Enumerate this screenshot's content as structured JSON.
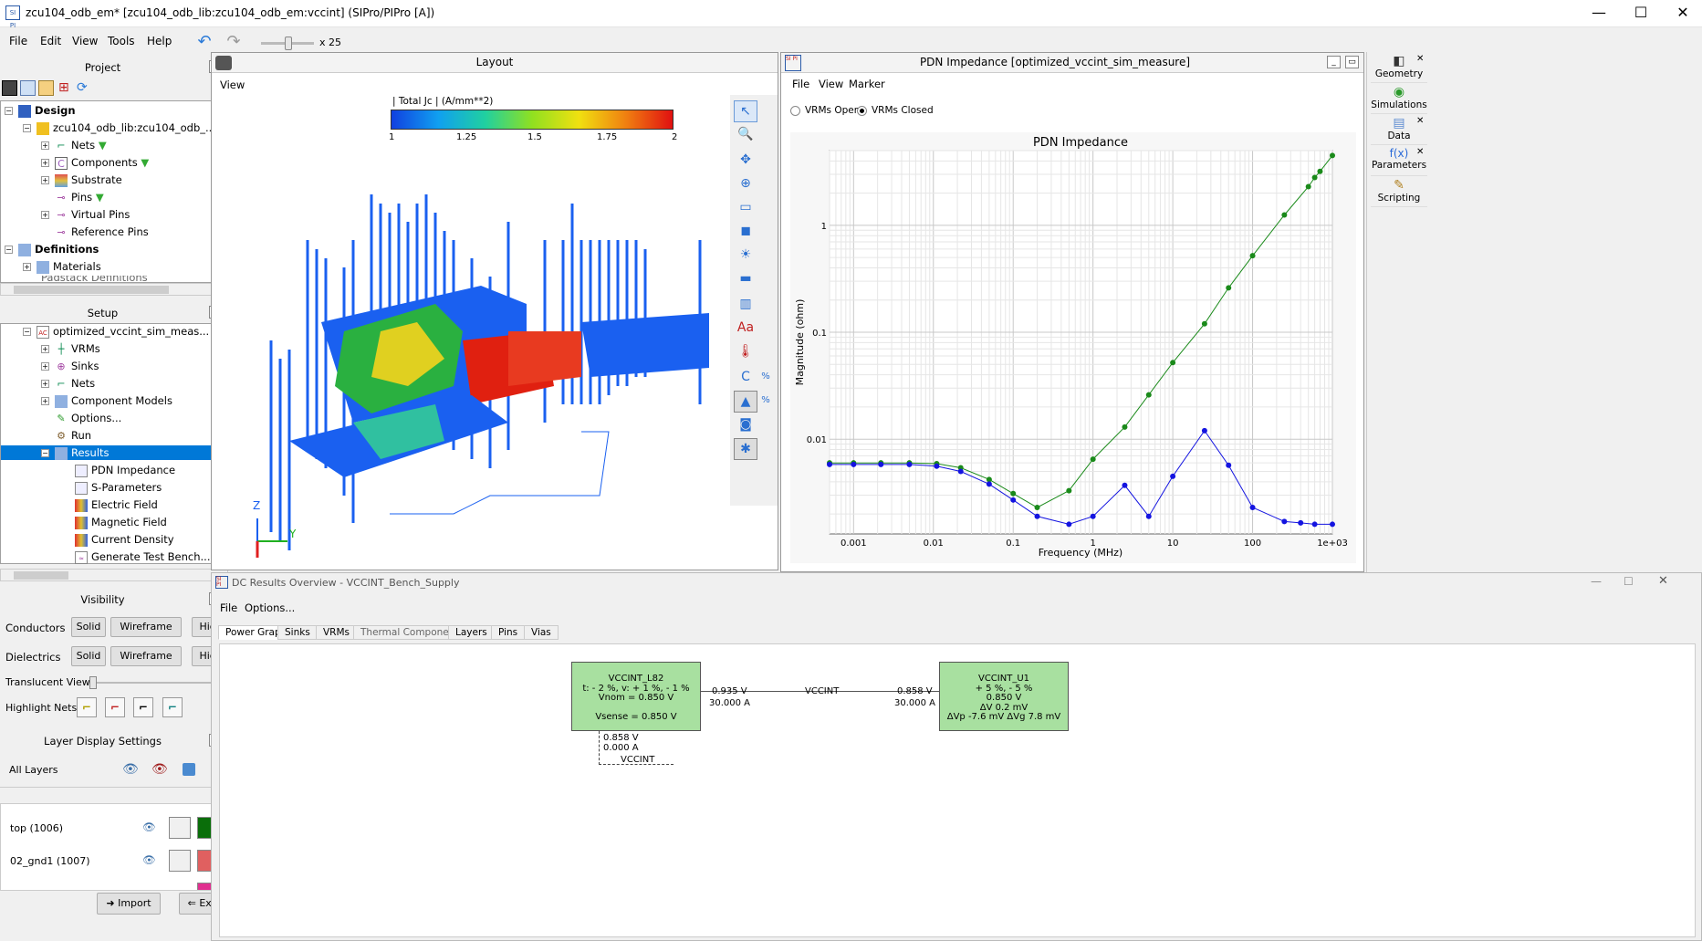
{
  "window": {
    "title": "zcu104_odb_em* [zcu104_odb_lib:zcu104_odb_em:vccint] (SIPro/PIPro [A])",
    "app_icon_text": "SI PI"
  },
  "menu": [
    "File",
    "Edit",
    "View",
    "Tools",
    "Help"
  ],
  "toolbar": {
    "zoom_label": "x 25"
  },
  "project": {
    "title": "Project",
    "design_label": "Design",
    "lib_label": "zcu104_odb_lib:zcu104_odb_...",
    "items": [
      "Nets",
      "Components",
      "Substrate",
      "Pins",
      "Virtual Pins",
      "Reference Pins"
    ],
    "definitions_label": "Definitions",
    "materials_label": "Materials",
    "cut_label": "Padstack Definitions"
  },
  "setup": {
    "title": "Setup",
    "sim_label": "optimized_vccint_sim_meas...",
    "items": [
      "VRMs",
      "Sinks",
      "Nets",
      "Component Models",
      "Options...",
      "Run",
      "Results"
    ],
    "results_children": [
      "PDN Impedance",
      "S-Parameters",
      "Electric Field",
      "Magnetic Field",
      "Current Density",
      "Generate Test Bench..."
    ]
  },
  "visibility": {
    "title": "Visibility",
    "conductors_label": "Conductors",
    "dielectrics_label": "Dielectrics",
    "solid": "Solid",
    "wireframe": "Wireframe",
    "hide": "Hide",
    "translucent_label": "Translucent View:",
    "highlight_label": "Highlight Nets:"
  },
  "layer_display": {
    "title": "Layer Display Settings",
    "all_layers": "All Layers",
    "layers": [
      {
        "name": "top (1006)",
        "color": "#0a6e0a"
      },
      {
        "name": "02_gnd1 (1007)",
        "color": "#e06060"
      }
    ],
    "import_label": "Import",
    "export_label": "Export"
  },
  "layout": {
    "title": "Layout",
    "menu_view": "View",
    "colorbar_title": "| Total Jc | (A/mm**2)",
    "colorbar_ticks": [
      "1",
      "1.25",
      "1.5",
      "1.75",
      "2"
    ],
    "axis_z": "Z",
    "axis_y": "Y"
  },
  "pdn": {
    "title": "PDN Impedance [optimized_vccint_sim_measure]",
    "menus": [
      "File",
      "View",
      "Marker"
    ],
    "radio_open": "VRMs Open",
    "radio_closed": "VRMs Closed",
    "selected_radio": "VRMs Closed"
  },
  "chart_data": {
    "type": "line",
    "title": "PDN Impedance",
    "xlabel": "Frequency (MHz)",
    "ylabel": "Magnitude (ohm)",
    "x_scale": "log",
    "y_scale": "log",
    "xlim": [
      0.0005,
      1000
    ],
    "ylim": [
      0.0013,
      5
    ],
    "x_ticks": [
      "0.001",
      "0.01",
      "0.1",
      "1",
      "10",
      "100",
      "1e+03"
    ],
    "y_ticks": [
      "0.01",
      "0.1",
      "1"
    ],
    "grid": true,
    "series": [
      {
        "color": "#1a8a1a",
        "x": [
          0.0005,
          0.001,
          0.0022,
          0.005,
          0.011,
          0.022,
          0.05,
          0.1,
          0.2,
          0.5,
          1,
          2.5,
          5,
          10,
          25,
          50,
          100,
          250,
          500,
          600,
          700,
          1000
        ],
        "y": [
          0.006,
          0.006,
          0.006,
          0.006,
          0.0059,
          0.0054,
          0.0042,
          0.0031,
          0.0023,
          0.0033,
          0.0065,
          0.013,
          0.026,
          0.052,
          0.12,
          0.26,
          0.52,
          1.25,
          2.3,
          2.8,
          3.2,
          4.5
        ]
      },
      {
        "color": "#1414e0",
        "x": [
          0.0005,
          0.001,
          0.0022,
          0.005,
          0.011,
          0.022,
          0.05,
          0.1,
          0.2,
          0.5,
          1,
          2.5,
          5,
          10,
          25,
          50,
          100,
          250,
          400,
          600,
          1000
        ],
        "y": [
          0.0058,
          0.0058,
          0.0058,
          0.0058,
          0.0056,
          0.005,
          0.0038,
          0.0027,
          0.0019,
          0.0016,
          0.0019,
          0.0037,
          0.0019,
          0.0045,
          0.012,
          0.0057,
          0.0023,
          0.0017,
          0.00165,
          0.0016,
          0.0016
        ]
      }
    ]
  },
  "dock": [
    "Geometry",
    "Simulations",
    "Data",
    "Parameters",
    "Scripting"
  ],
  "dc_results": {
    "title": "DC Results Overview - VCCINT_Bench_Supply",
    "menus": [
      "File",
      "Options..."
    ],
    "tabs": [
      "Power Graph",
      "Sinks",
      "VRMs",
      "Thermal Components",
      "Layers",
      "Pins",
      "Vias"
    ],
    "vrm": {
      "name": "VCCINT_L82",
      "l1": "t: - 2 %, v: + 1 %, - 1 %",
      "l2": "Vnom = 0.850 V",
      "l3": "Vsense = 0.850 V"
    },
    "left_v": "0.935 V",
    "left_a": "30.000 A",
    "net": "VCCINT",
    "right_v": "0.858 V",
    "right_a": "30.000 A",
    "sink": {
      "name": "VCCINT_U1",
      "l1": "+ 5 %, - 5 %",
      "l2": "0.850 V",
      "l3": "ΔV 0.2 mV",
      "l4": "ΔVp -7.6 mV  ΔVg 7.8 mV"
    },
    "sense_v": "0.858 V",
    "sense_a": "0.000 A",
    "sense_net": "VCCINT"
  }
}
